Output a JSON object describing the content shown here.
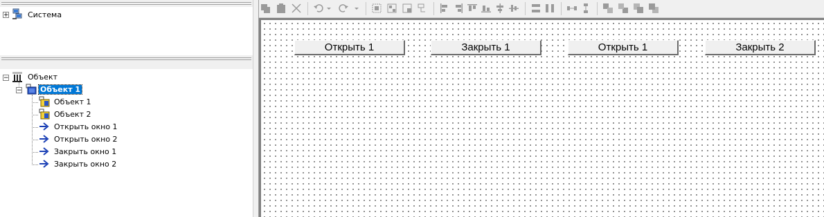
{
  "system_tree": {
    "root_label": "Система"
  },
  "object_tree": {
    "root_label": "Объект",
    "selected_label": "Объект 1",
    "children": [
      "Объект 1",
      "Объект 2",
      "Открыть окно 1",
      "Открыть окно 2",
      "Закрыть окно 1",
      "Закрыть окно 2"
    ]
  },
  "form_buttons": [
    "Открыть 1",
    "Закрыть 1",
    "Открыть 1",
    "Закрыть 2"
  ]
}
